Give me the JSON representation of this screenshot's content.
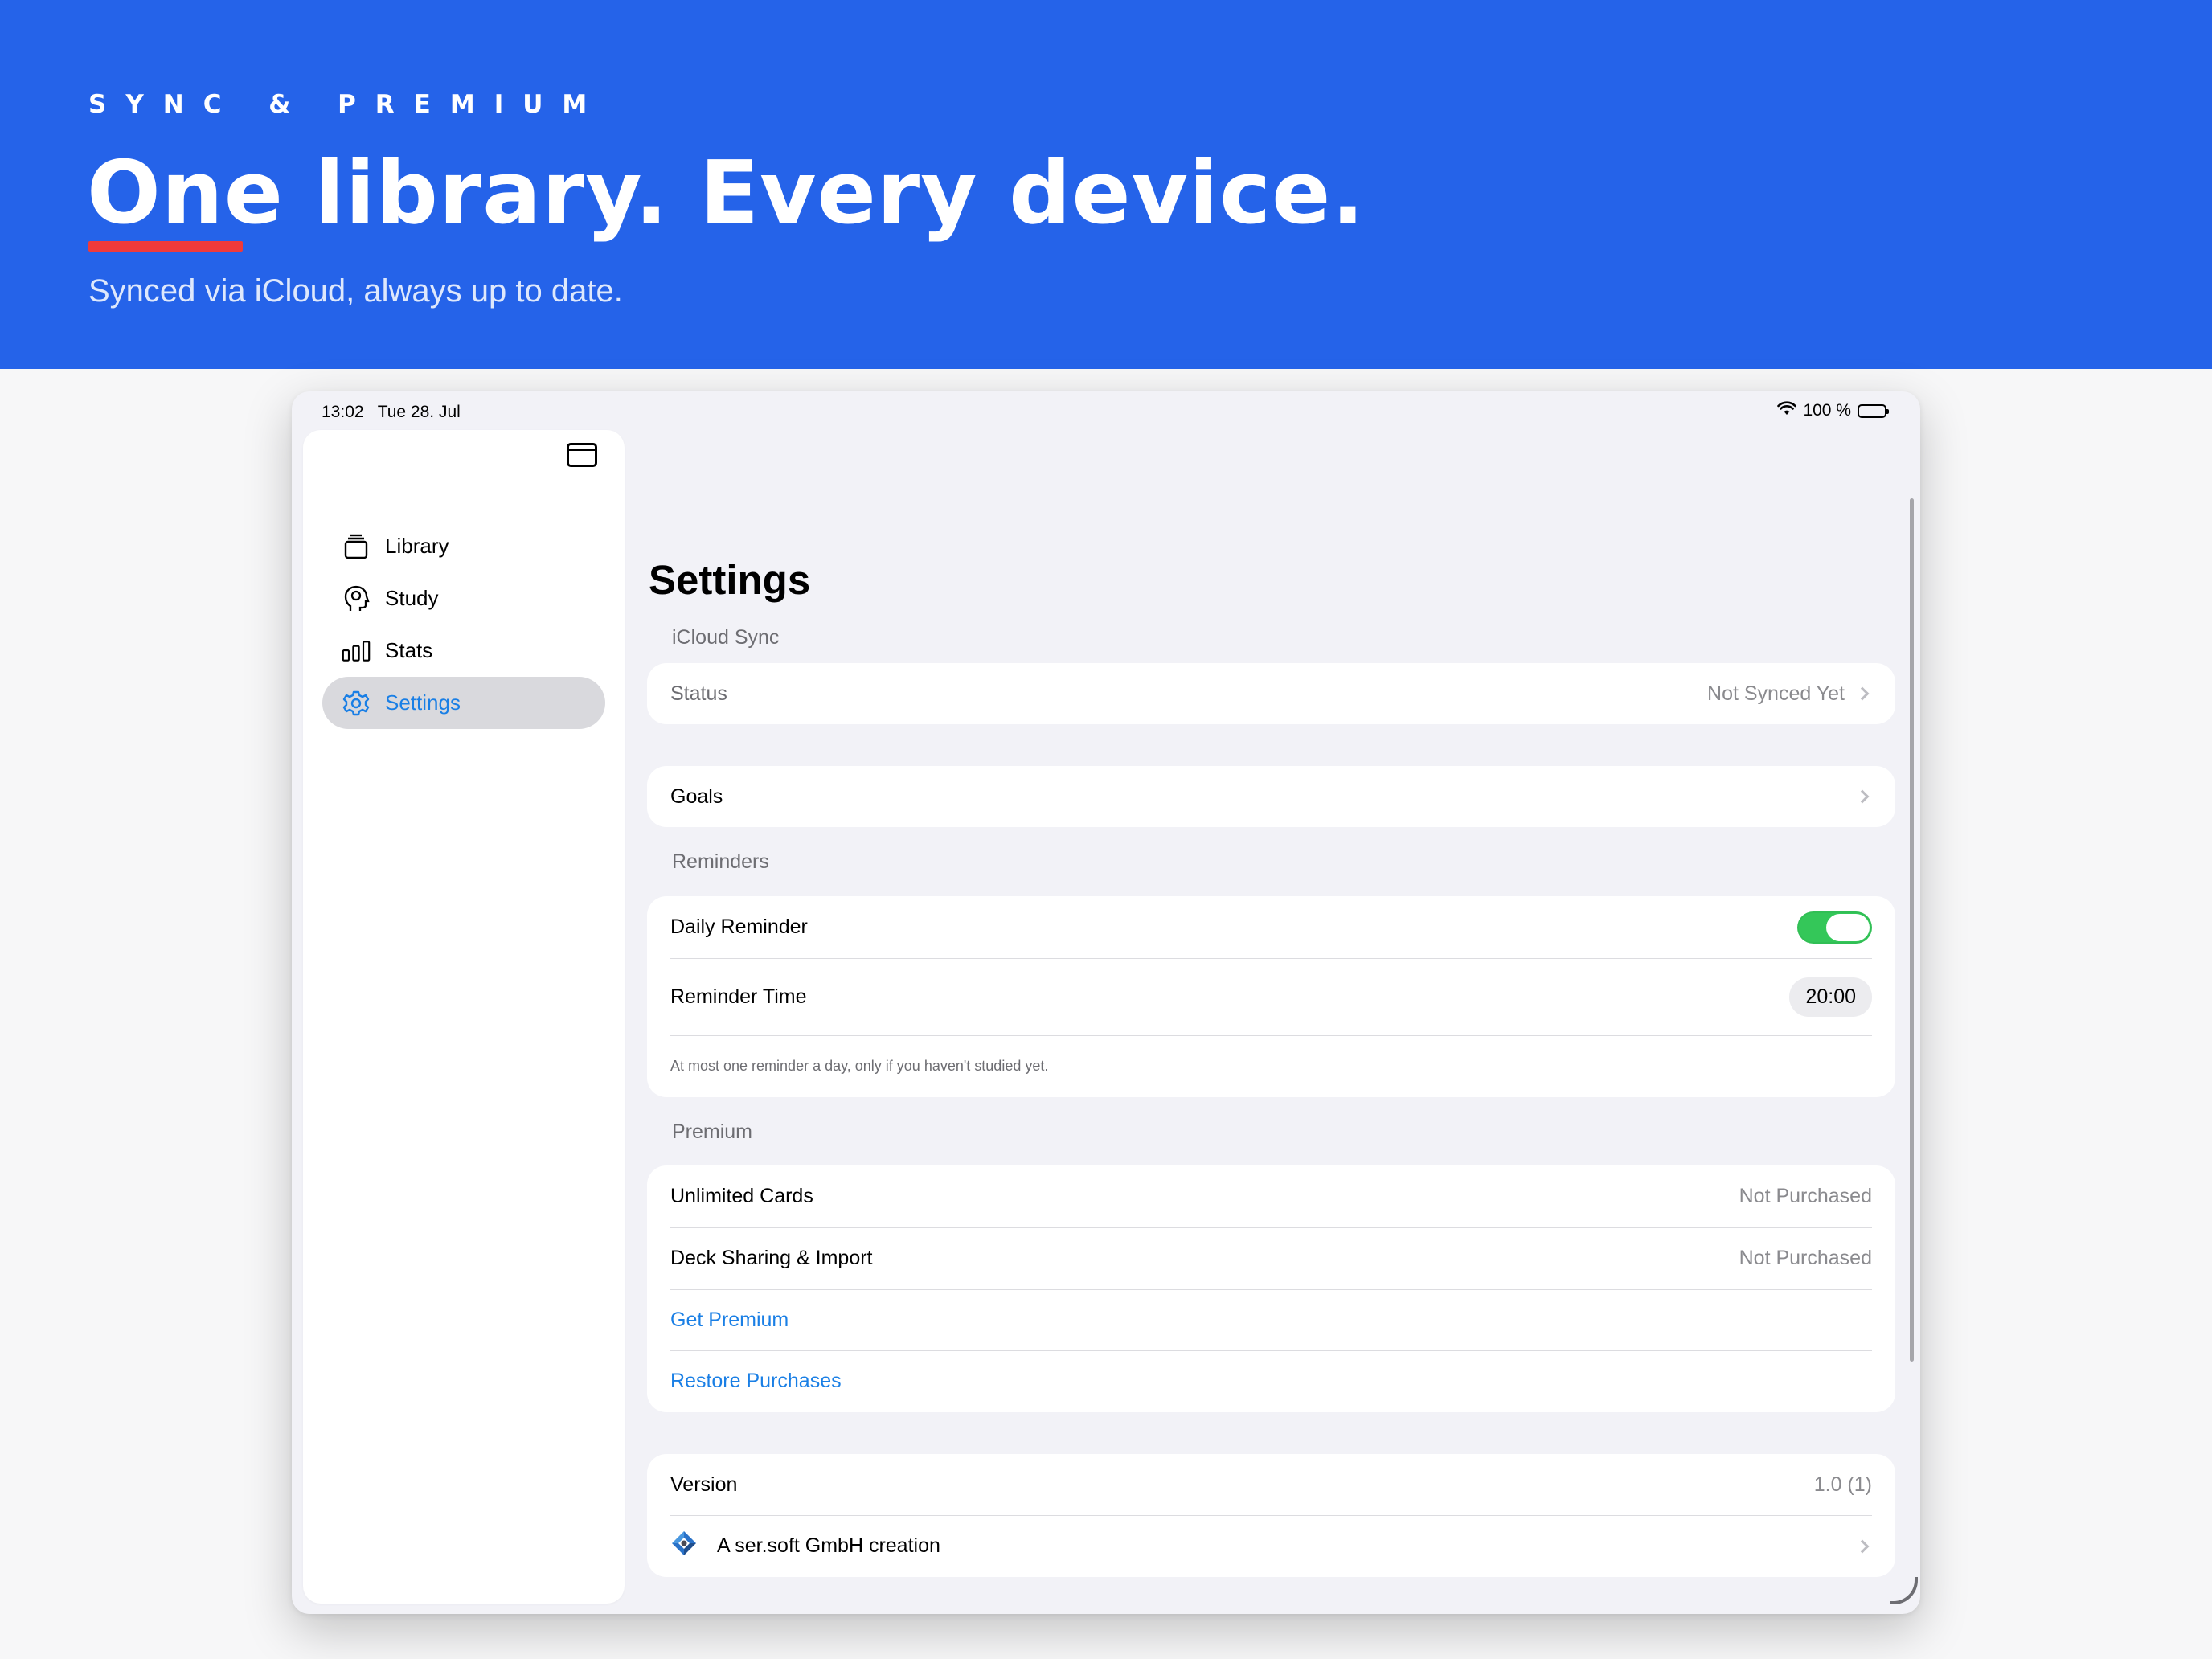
{
  "hero": {
    "eyebrow": "SYNC & PREMIUM",
    "headline": "One library. Every device.",
    "subline": "Synced via iCloud, always up to date."
  },
  "statusbar": {
    "time": "13:02",
    "date": "Tue 28. Jul",
    "battery": "100 %"
  },
  "sidebar": {
    "items": [
      {
        "label": "Library",
        "icon": "library-icon"
      },
      {
        "label": "Study",
        "icon": "brain-head-icon"
      },
      {
        "label": "Stats",
        "icon": "bar-chart-icon"
      },
      {
        "label": "Settings",
        "icon": "gear-icon",
        "selected": true
      }
    ]
  },
  "settings": {
    "title": "Settings",
    "icloud": {
      "header": "iCloud Sync",
      "status_label": "Status",
      "status_value": "Not Synced Yet"
    },
    "goals": {
      "label": "Goals"
    },
    "reminders": {
      "header": "Reminders",
      "daily_label": "Daily Reminder",
      "daily_enabled": true,
      "time_label": "Reminder Time",
      "time_value": "20:00",
      "footnote": "At most one reminder a day, only if you haven't studied yet."
    },
    "premium": {
      "header": "Premium",
      "unlimited_label": "Unlimited Cards",
      "unlimited_value": "Not Purchased",
      "sharing_label": "Deck Sharing & Import",
      "sharing_value": "Not Purchased",
      "get_premium": "Get Premium",
      "restore": "Restore Purchases"
    },
    "about": {
      "version_label": "Version",
      "version_value": "1.0 (1)",
      "credit": "A ser.soft GmbH creation"
    }
  },
  "colors": {
    "hero_bg": "#2563e9",
    "accent": "#1a7fe5",
    "toggle_on": "#34c759",
    "underline": "#ef3a3a"
  }
}
